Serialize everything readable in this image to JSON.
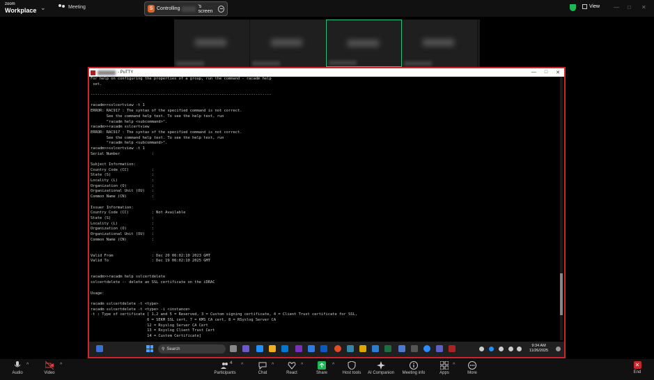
{
  "zoom": {
    "brand_small": "zoom",
    "brand_big": "Workplace",
    "meeting_label": "Meeting",
    "control_tab": {
      "badge": "S",
      "prefix": "Controlling",
      "suffix": "'s screen"
    },
    "view_label": "View"
  },
  "gallery": {
    "tile_count": 4,
    "active_index": 2
  },
  "putty": {
    "title_suffix": "- PuTTY",
    "terminal_lines": [
      "For help on configuring the properties of a group, run the command - racadm help",
      " set.",
      "",
      "--------------------------------------------------------------------------------",
      "",
      "racadm>>sslcertview -t 1",
      "ERROR: RAC917 : The syntax of the specified command is not correct.",
      "       See the command help text. To see the help text, run",
      "       \"racadm help <subcommand>\".",
      "racadm>>racadm sslcertview",
      "ERROR: RAC917 : The syntax of the specified command is not correct.",
      "       See the command help text. To see the help text, run",
      "       \"racadm help <subcommand>\".",
      "racadm>>sslcertview -t 1",
      "Serial Number              : ",
      "",
      "Subject Information:",
      "Country Code (CC)          : ",
      "State (S)                  : ",
      "Locality (L)               : ",
      "Organization (O)           : ",
      "Organizational Unit (OU)   : ",
      "Common Name (CN)           : ",
      "",
      "Issuer Information:",
      "Country Code (CC)          : Not Available",
      "State (S)                  : ",
      "Locality (L)               : ",
      "Organization (O)           : ",
      "Organizational Unit (OU)   : ",
      "Common Name (CN)           : ",
      "",
      "",
      "Valid From                 : Dec 20 06:02:10 2023 GMT",
      "Valid To                   : Dec 19 06:02:10 2025 GMT",
      "",
      "",
      "racadm>>racadm help sslcertdelete",
      "sslcertdelete -- delete an SSL certificate on the iDRAC",
      "",
      "Usage:",
      "",
      "racadm sslcertdelete -t <type>",
      "racadm sslcertdelete -t <type> -i <instance>",
      "-t : Type of certificate [ 1,2 and 5 = Reserved, 3 = Custom signing certificate, 4 = Client Trust certificate for SSL,",
      "                         6 = SEKM SSL cert, 7 = KMS CA cert, 8 = RSyslog Server CA",
      "                         12 = Rsyslog Server CA Cert",
      "                         13 = Rsyslog Client Trust Cert",
      "                         14 = Custom Certificate]"
    ]
  },
  "taskbar": {
    "search_label": "Search",
    "time": "9:34 AM",
    "date": "11/26/2025"
  },
  "toolbar": {
    "audio": "Audio",
    "video": "Video",
    "participants": "Participants",
    "participants_count": "4",
    "chat": "Chat",
    "react": "React",
    "share": "Share",
    "host_tools": "Host tools",
    "ai_companion": "AI Companion",
    "meeting_info": "Meeting info",
    "apps": "Apps",
    "more": "More",
    "end": "End"
  },
  "colors": {
    "share_accent": "#1db954",
    "end_red": "#c9252c",
    "putty_border": "#d0232a",
    "active_tile": "#26c281"
  }
}
